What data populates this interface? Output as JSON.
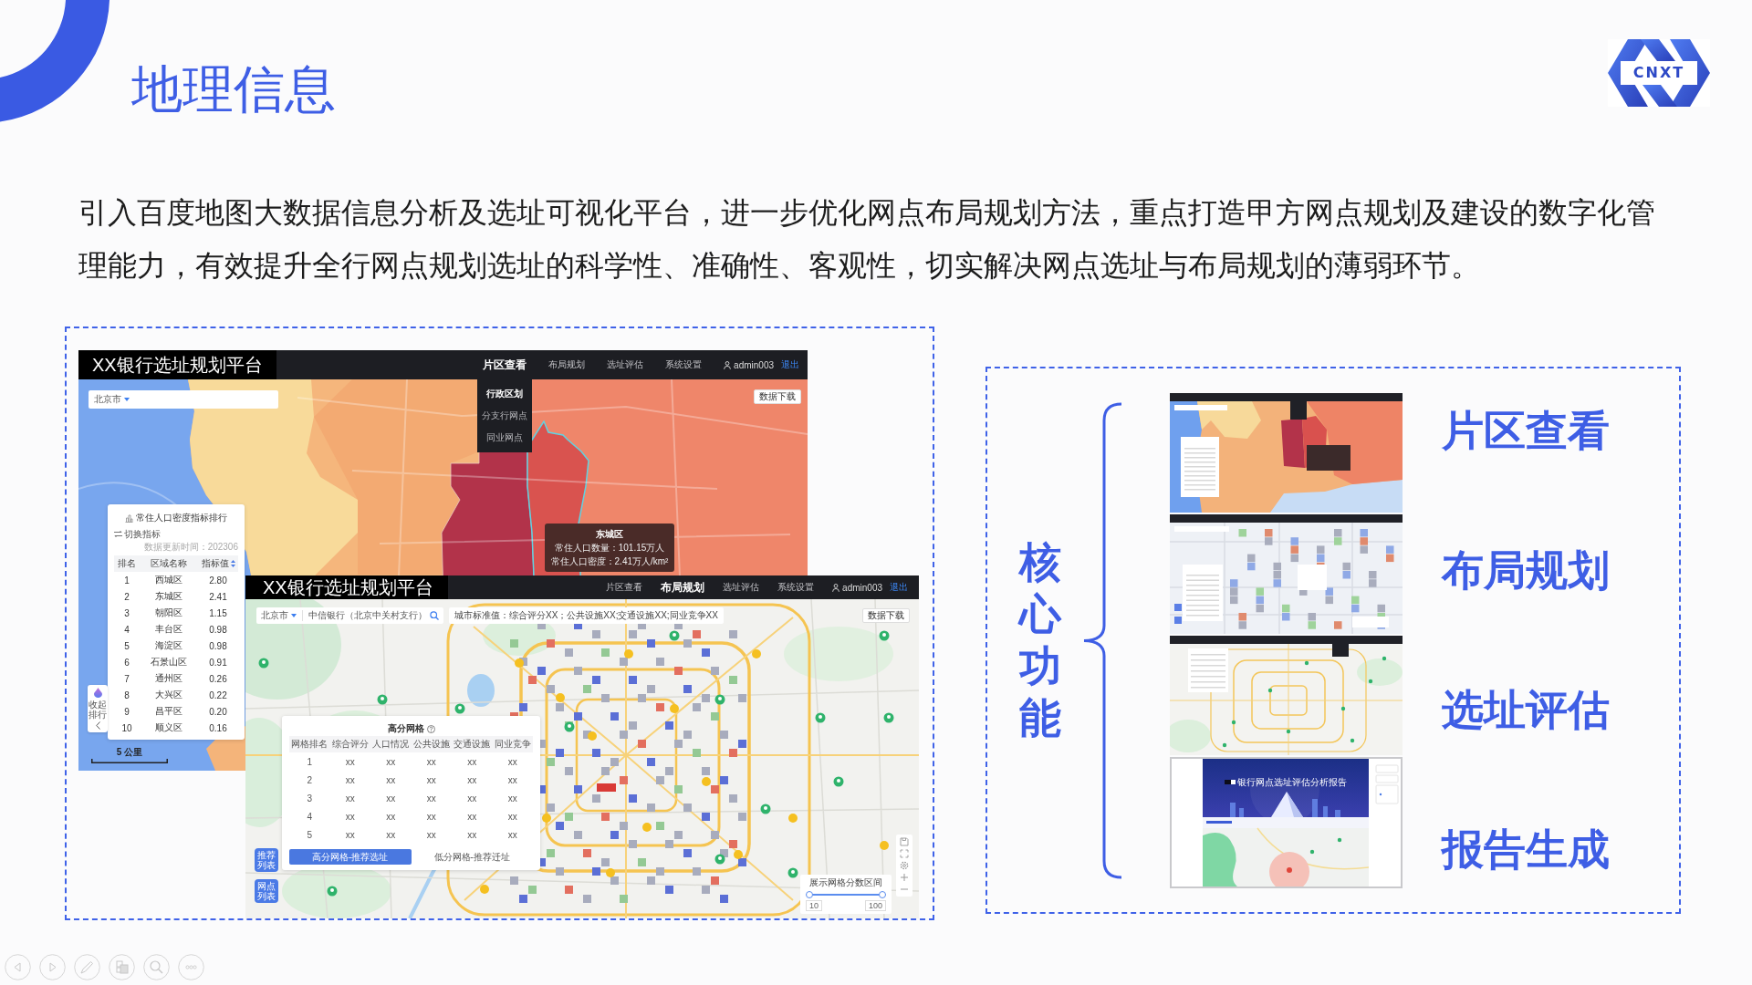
{
  "slide": {
    "title": "地理信息",
    "logo": "CNXT",
    "intro": "引入百度地图大数据信息分析及选址可视化平台，进一步优化网点布局规划方法，重点打造甲方网点规划及建设的数字化管理能力，有效提升全行网点规划选址的科学性、准确性、客观性，切实解决网点选址与布局规划的薄弱环节。"
  },
  "district_screen": {
    "app_title": "XX银行选址规划平台",
    "nav": [
      {
        "label": "片区查看",
        "selected": true
      },
      {
        "label": "布局规划",
        "selected": false
      },
      {
        "label": "选址评估",
        "selected": false
      },
      {
        "label": "系统设置",
        "selected": false
      }
    ],
    "user": "admin003",
    "logout": "退出",
    "menu": [
      {
        "label": "行政区划",
        "selected": true
      },
      {
        "label": "分支行网点",
        "selected": false
      },
      {
        "label": "同业网点",
        "selected": false
      }
    ],
    "city_select": "北京市",
    "download_button": "数据下载",
    "tooltip": {
      "title": "东城区",
      "lines": [
        "常住人口数量：101.15万人",
        "常住人口密度：2.41万人/km²"
      ]
    },
    "ranking": {
      "title": "常住人口密度指标排行",
      "switch_button": "切换指标",
      "updated": "数据更新时间：202306",
      "columns": [
        "排名",
        "区域名称",
        "指标值"
      ],
      "rows": [
        [
          "1",
          "西城区",
          "2.80"
        ],
        [
          "2",
          "东城区",
          "2.41"
        ],
        [
          "3",
          "朝阳区",
          "1.15"
        ],
        [
          "4",
          "丰台区",
          "0.98"
        ],
        [
          "5",
          "海淀区",
          "0.98"
        ],
        [
          "6",
          "石景山区",
          "0.91"
        ],
        [
          "7",
          "通州区",
          "0.26"
        ],
        [
          "8",
          "大兴区",
          "0.22"
        ],
        [
          "9",
          "昌平区",
          "0.20"
        ],
        [
          "10",
          "顺义区",
          "0.16"
        ]
      ]
    },
    "collapse_button": "收起排行",
    "scale": "5 公里"
  },
  "grid_screen": {
    "app_title": "XX银行选址规划平台",
    "nav": [
      {
        "label": "片区查看",
        "selected": false
      },
      {
        "label": "布局规划",
        "selected": true
      },
      {
        "label": "选址评估",
        "selected": false
      },
      {
        "label": "系统设置",
        "selected": false
      }
    ],
    "user": "admin003",
    "logout": "退出",
    "city_select": "北京市",
    "search": {
      "value": "中信银行（北京中关村支行）"
    },
    "standard": "城市标准值：综合评分XX；公共设施XX;交通设施XX;同业竞争XX",
    "download_button": "数据下载",
    "grid_panel": {
      "title": "高分网格",
      "columns": [
        "网格排名",
        "综合评分",
        "人口情况",
        "公共设施",
        "交通设施",
        "同业竞争"
      ],
      "rows": [
        [
          "1",
          "xx",
          "xx",
          "xx",
          "xx",
          "xx"
        ],
        [
          "2",
          "xx",
          "xx",
          "xx",
          "xx",
          "xx"
        ],
        [
          "3",
          "xx",
          "xx",
          "xx",
          "xx",
          "xx"
        ],
        [
          "4",
          "xx",
          "xx",
          "xx",
          "xx",
          "xx"
        ],
        [
          "5",
          "xx",
          "xx",
          "xx",
          "xx",
          "xx"
        ]
      ],
      "tabs": [
        {
          "label": "高分网格-推荐选址",
          "selected": true
        },
        {
          "label": "低分网格-推荐迁址",
          "selected": false
        }
      ]
    },
    "side_buttons": [
      "推荐列表",
      "网点列表"
    ],
    "range": {
      "title": "展示网格分数区间",
      "min": "10",
      "max": "100",
      "level": 1
    }
  },
  "features": {
    "heading": "核心功能",
    "items": [
      {
        "label": "片区查看",
        "kind": "choropleth"
      },
      {
        "label": "布局规划",
        "kind": "grid"
      },
      {
        "label": "选址评估",
        "kind": "streets"
      },
      {
        "label": "报告生成",
        "kind": "report",
        "report_title": "银行网点选址评估分析报告"
      }
    ]
  }
}
